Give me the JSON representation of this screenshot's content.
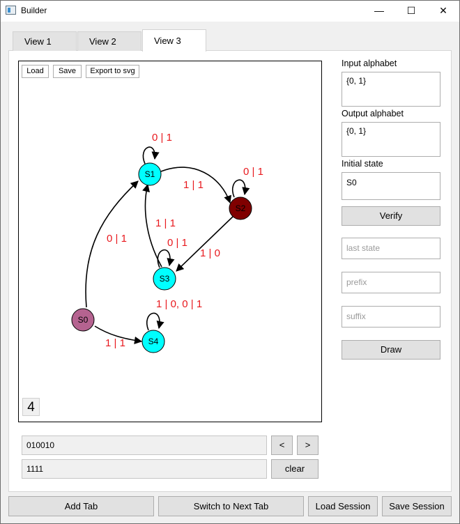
{
  "window": {
    "title": "Builder",
    "minimize_glyph": "—",
    "maximize_glyph": "☐",
    "close_glyph": "✕"
  },
  "tabs": [
    {
      "label": "View 1"
    },
    {
      "label": "View 2"
    },
    {
      "label": "View 3"
    }
  ],
  "active_tab": "View 3",
  "canvas_toolbar": {
    "load": "Load",
    "save": "Save",
    "export": "Export to svg"
  },
  "graph": {
    "states": [
      {
        "id": "S0",
        "label": "S0",
        "color": "#b56390"
      },
      {
        "id": "S1",
        "label": "S1",
        "color": "#00ffff"
      },
      {
        "id": "S2",
        "label": "S2",
        "color": "#800000"
      },
      {
        "id": "S3",
        "label": "S3",
        "color": "#00ffff"
      },
      {
        "id": "S4",
        "label": "S4",
        "color": "#00ffff"
      }
    ],
    "transitions": [
      {
        "from": "S1",
        "to": "S1",
        "label": "0 | 1"
      },
      {
        "from": "S1",
        "to": "S2",
        "label": "1 | 1"
      },
      {
        "from": "S2",
        "to": "S2",
        "label": "0 | 1"
      },
      {
        "from": "S2",
        "to": "S3",
        "label": "1 | 0"
      },
      {
        "from": "S3",
        "to": "S1",
        "label": "1 | 1"
      },
      {
        "from": "S3",
        "to": "S3",
        "label": "0 | 1"
      },
      {
        "from": "S0",
        "to": "S1",
        "label": "0 | 1"
      },
      {
        "from": "S0",
        "to": "S4",
        "label": "1 | 1"
      },
      {
        "from": "S4",
        "to": "S4",
        "label": "1 | 0, 0 | 1"
      }
    ],
    "label_color": "#e8191e"
  },
  "step_counter": "4",
  "sidebar": {
    "input_alphabet_label": "Input alphabet",
    "input_alphabet_value": "{0, 1}",
    "output_alphabet_label": "Output alphabet",
    "output_alphabet_value": "{0, 1}",
    "initial_state_label": "Initial state",
    "initial_state_value": "S0",
    "verify_button": "Verify",
    "last_state_placeholder": "last state",
    "prefix_placeholder": "prefix",
    "suffix_placeholder": "suffix",
    "draw_button": "Draw"
  },
  "sequence": {
    "input_value": "010010",
    "prev_button": "<",
    "next_button": ">",
    "output_value": "1111",
    "clear_button": "clear"
  },
  "footer": {
    "add_tab": "Add Tab",
    "switch_tab": "Switch to Next Tab",
    "load_session": "Load Session",
    "save_session": "Save Session"
  }
}
